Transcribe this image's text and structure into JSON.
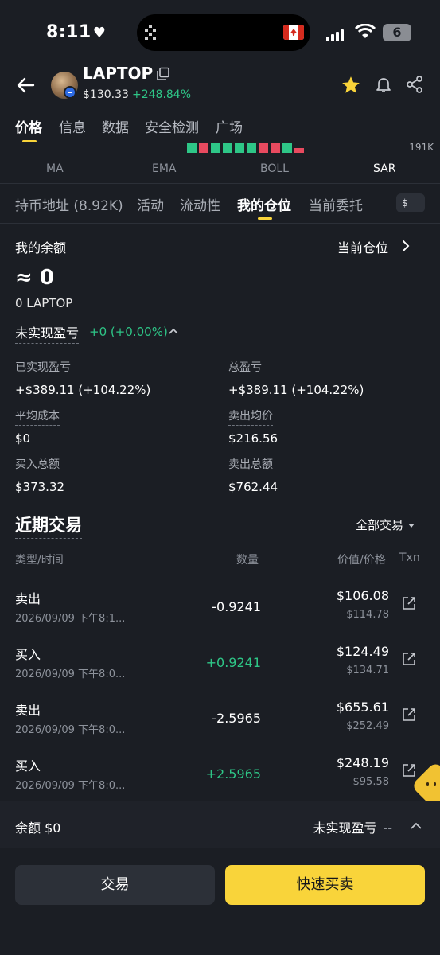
{
  "status_bar": {
    "time": "8:11",
    "heart": "♥",
    "battery": "6"
  },
  "header": {
    "token_name": "LAPTOP",
    "price": "$130.33",
    "change": "+248.84%"
  },
  "main_tabs": [
    "价格",
    "信息",
    "数据",
    "安全检测",
    "广场"
  ],
  "chart_strip": {
    "axis_label": "191K"
  },
  "indicator_tabs": [
    "MA",
    "EMA",
    "BOLL",
    "SAR"
  ],
  "sub_tabs": [
    "持币地址 (8.92K)",
    "活动",
    "流动性",
    "我的仓位",
    "当前委托"
  ],
  "currency_chip": "$",
  "balance": {
    "label": "我的余额",
    "link": "当前仓位",
    "approx_value": "≈ 0",
    "token_amount": "0 LAPTOP",
    "unrealized_label": "未实现盈亏",
    "unrealized_value": "+0 (+0.00%)"
  },
  "stats": {
    "realized_label": "已实现盈亏",
    "realized_value": "+$389.11 (+104.22%)",
    "total_label": "总盈亏",
    "total_value": "+$389.11 (+104.22%)",
    "avg_cost_label": "平均成本",
    "avg_cost_value": "$0",
    "avg_sell_label": "卖出均价",
    "avg_sell_value": "$216.56",
    "total_buy_label": "买入总额",
    "total_buy_value": "$373.32",
    "total_sell_label": "卖出总额",
    "total_sell_value": "$762.44"
  },
  "recent": {
    "title": "近期交易",
    "filter": "全部交易",
    "columns": {
      "type_time": "类型/时间",
      "qty": "数量",
      "value_price": "价值/价格",
      "txn": "Txn"
    },
    "rows": [
      {
        "type": "卖出",
        "time": "2026/09/09 下午8:1...",
        "qty": "-0.9241",
        "value": "$106.08",
        "price": "$114.78"
      },
      {
        "type": "买入",
        "time": "2026/09/09 下午8:0...",
        "qty": "+0.9241",
        "value": "$124.49",
        "price": "$134.71"
      },
      {
        "type": "卖出",
        "time": "2026/09/09 下午8:0...",
        "qty": "-2.5965",
        "value": "$655.61",
        "price": "$252.49"
      },
      {
        "type": "买入",
        "time": "2026/09/09 下午8:0...",
        "qty": "+2.5965",
        "value": "$248.19",
        "price": "$95.58"
      }
    ]
  },
  "footer": {
    "balance": "余额 $0",
    "upnl_label": "未实现盈亏",
    "upnl_value": "--"
  },
  "actions": {
    "trade": "交易",
    "quick_trade": "快速买卖"
  },
  "colors": {
    "accent": "#f9d43a",
    "positive": "#2ec687",
    "negative": "#e84a5f",
    "background": "#1b1e24"
  },
  "icons": [
    "back-arrow-icon",
    "copy-icon",
    "star-icon",
    "bell-icon",
    "share-icon",
    "chevron-right-icon",
    "chevron-up-icon",
    "external-link-icon"
  ]
}
